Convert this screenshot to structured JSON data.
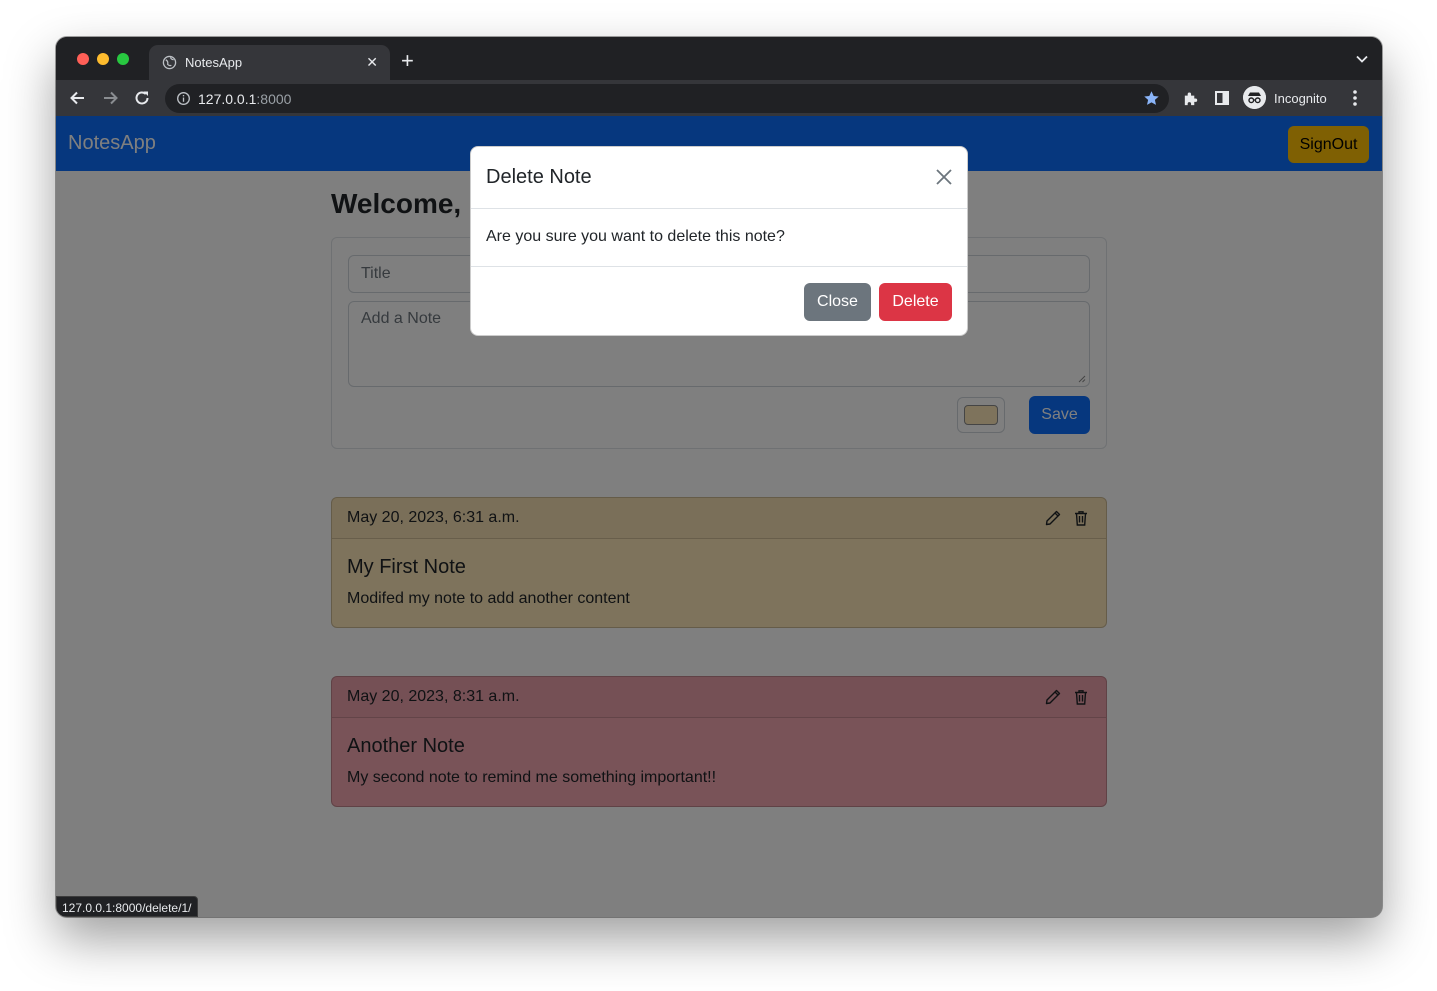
{
  "browser": {
    "tab_title": "NotesApp",
    "tab_close": "✕",
    "new_tab": "+",
    "url_host": "127.0.0.1",
    "url_port": ":8000",
    "profile_label": "Incognito",
    "status_url": "127.0.0.1:8000/delete/1/",
    "icons": [
      "globe-icon",
      "back-icon",
      "forward-icon",
      "reload-icon",
      "info-icon",
      "bookmark-star-icon",
      "extensions-icon",
      "side-panel-icon",
      "incognito-icon",
      "menu-icon",
      "tab-search-icon"
    ]
  },
  "navbar": {
    "brand": "NotesApp",
    "signout_label": "SignOut",
    "bg_color": "#0d6efd",
    "signout_color": "#ffc107"
  },
  "main": {
    "welcome": "Welcome, s",
    "form": {
      "title_placeholder": "Title",
      "note_placeholder": "Add a Note",
      "color_value": "#fde7b8",
      "save_label": "Save"
    },
    "notes": [
      {
        "date": "May 20, 2023, 6:31 a.m.",
        "title": "My First Note",
        "body": "Modifed my note to add another content",
        "color": "#fde7b8"
      },
      {
        "date": "May 20, 2023, 8:31 a.m.",
        "title": "Another Note",
        "body": "My second note to remind me something important!!",
        "color": "#f2a6b0"
      }
    ]
  },
  "modal": {
    "title": "Delete Note",
    "body": "Are you sure you want to delete this note?",
    "close_label": "Close",
    "delete_label": "Delete",
    "close_color": "#6c757d",
    "delete_color": "#dc3545"
  }
}
